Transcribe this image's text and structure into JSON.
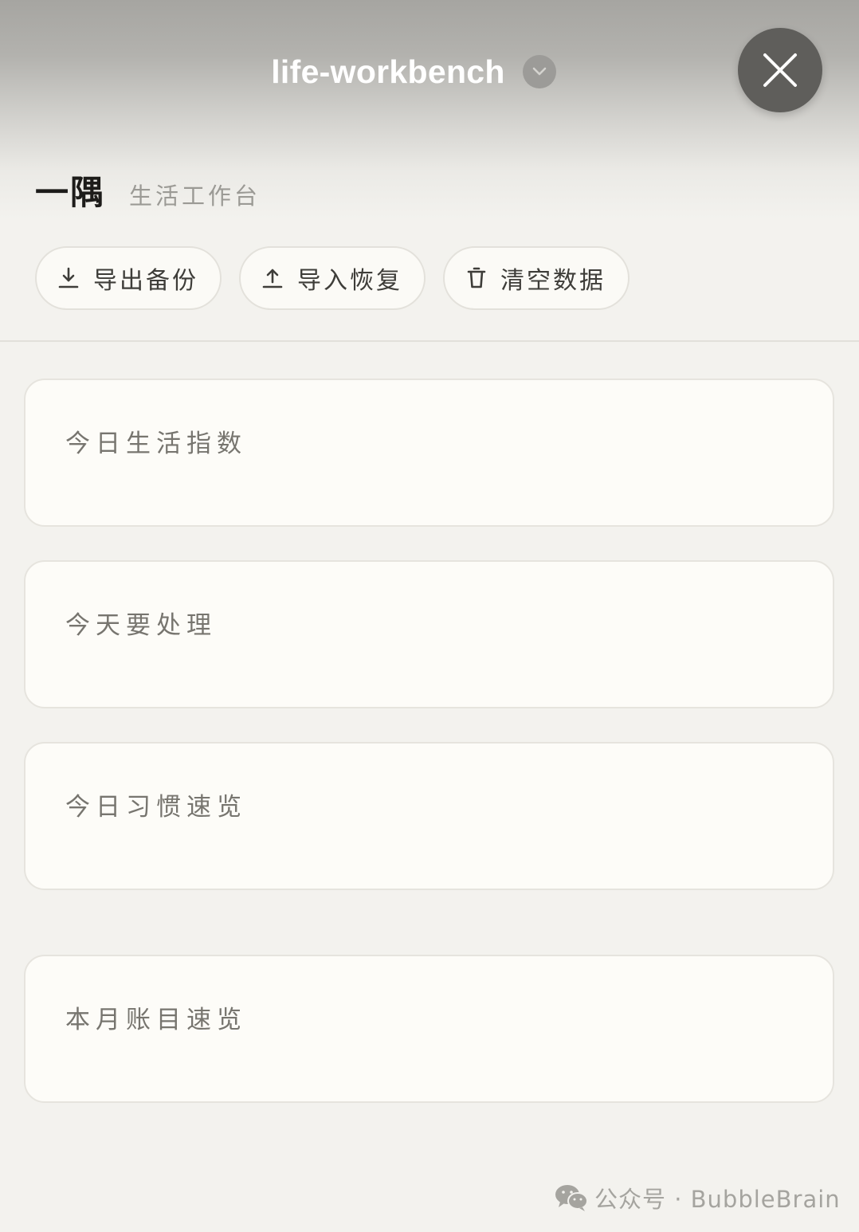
{
  "topbar": {
    "title": "life-workbench",
    "dropdown_icon": "chevron-down-icon",
    "close_icon": "close-icon"
  },
  "header": {
    "app_name": "一隅",
    "subtitle": "生活工作台"
  },
  "toolbar": {
    "export": {
      "label": "导出备份",
      "icon": "download-icon"
    },
    "import": {
      "label": "导入恢复",
      "icon": "upload-icon"
    },
    "clear": {
      "label": "清空数据",
      "icon": "trash-icon"
    }
  },
  "cards": [
    {
      "title": "今日生活指数"
    },
    {
      "title": "今天要处理"
    },
    {
      "title": "今日习惯速览"
    },
    {
      "title": "本月账目速览"
    }
  ],
  "watermark": {
    "icon": "wechat-icon",
    "text": "公众号 · BubbleBrain"
  },
  "colors": {
    "background": "#f3f2ee",
    "card": "#fdfcf8",
    "close_button": "#5f5e5b",
    "title_text": "#1d1c1a",
    "muted_text": "#9b9a95"
  }
}
